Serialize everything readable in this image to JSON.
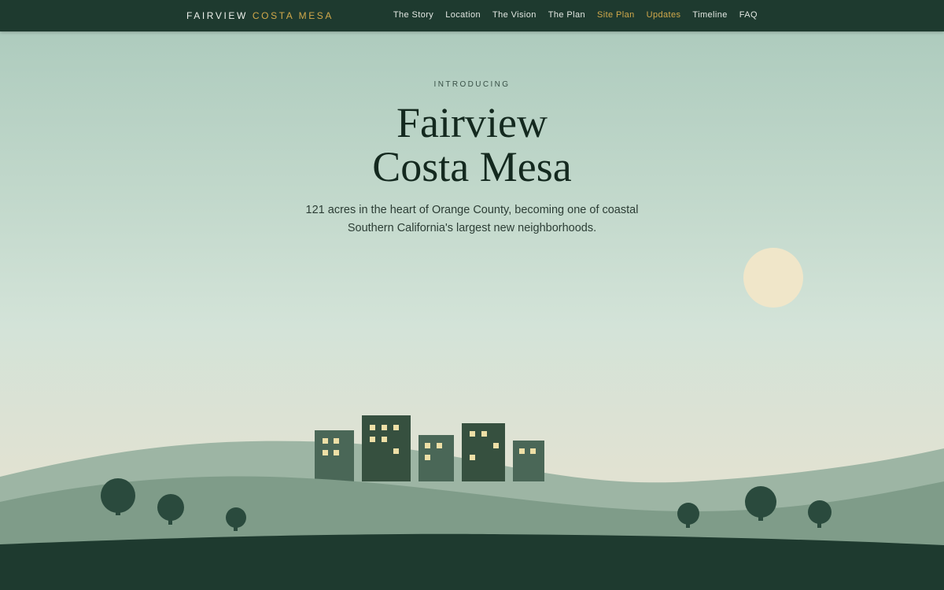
{
  "brand": {
    "name_primary": "FAIRVIEW",
    "name_accent": "COSTA MESA"
  },
  "nav": {
    "items": [
      {
        "label": "The Story",
        "highlight": false
      },
      {
        "label": "Location",
        "highlight": false
      },
      {
        "label": "The Vision",
        "highlight": false
      },
      {
        "label": "The Plan",
        "highlight": false
      },
      {
        "label": "Site Plan",
        "highlight": true
      },
      {
        "label": "Updates",
        "highlight": true
      },
      {
        "label": "Timeline",
        "highlight": false
      },
      {
        "label": "FAQ",
        "highlight": false
      }
    ]
  },
  "hero": {
    "eyebrow": "INTRODUCING",
    "title_line1": "Fairview",
    "title_line2": "Costa Mesa",
    "subtitle": "121 acres in the heart of Orange County, becoming one of coastal Southern California's largest new neighborhoods."
  },
  "colors": {
    "nav_bg": "#1e3a2f",
    "accent_gold": "#d2a94b",
    "sun": "#f0e6c9",
    "hill_light": "#9db5a4",
    "hill_mid": "#7f9c89",
    "ground_dark": "#1e3a2f",
    "building": "#3c5a4d",
    "window": "#eedfa6"
  },
  "scene": {
    "icons": [
      "sun-icon",
      "building-icon",
      "tree-icon",
      "hill-shape"
    ]
  }
}
